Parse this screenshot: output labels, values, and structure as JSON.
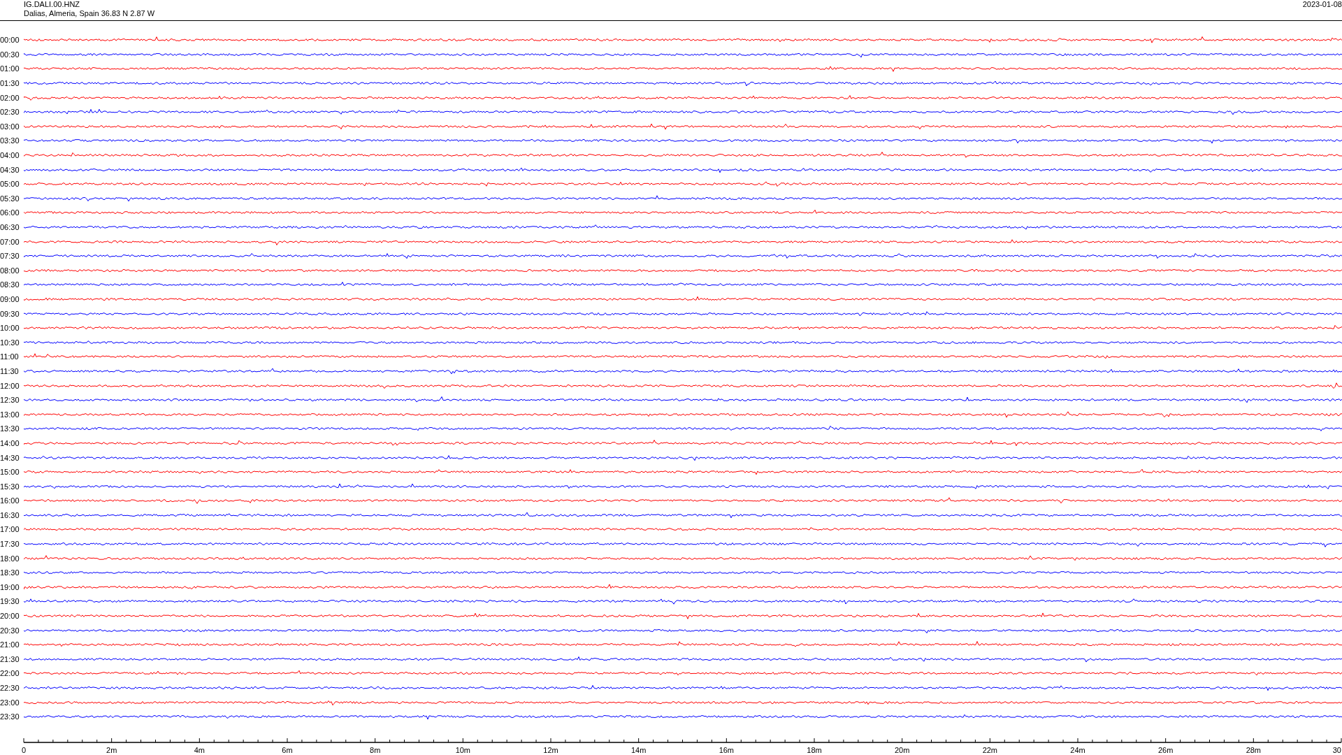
{
  "header": {
    "station": "IG.DALI.00.HNZ",
    "location": "Dalias, Almeria, Spain  36.83 N 2.87 W",
    "date": "2023-01-08"
  },
  "rows": [
    {
      "label": "00:00",
      "color": "#ff0000"
    },
    {
      "label": "00:30",
      "color": "#0000ff"
    },
    {
      "label": "01:00",
      "color": "#ff0000"
    },
    {
      "label": "01:30",
      "color": "#0000ff"
    },
    {
      "label": "02:00",
      "color": "#ff0000"
    },
    {
      "label": "02:30",
      "color": "#0000ff"
    },
    {
      "label": "03:00",
      "color": "#ff0000"
    },
    {
      "label": "03:30",
      "color": "#0000ff"
    },
    {
      "label": "04:00",
      "color": "#ff0000"
    },
    {
      "label": "04:30",
      "color": "#0000ff"
    },
    {
      "label": "05:00",
      "color": "#ff0000"
    },
    {
      "label": "05:30",
      "color": "#0000ff"
    },
    {
      "label": "06:00",
      "color": "#ff0000"
    },
    {
      "label": "06:30",
      "color": "#0000ff"
    },
    {
      "label": "07:00",
      "color": "#ff0000"
    },
    {
      "label": "07:30",
      "color": "#0000ff"
    },
    {
      "label": "08:00",
      "color": "#ff0000"
    },
    {
      "label": "08:30",
      "color": "#0000ff"
    },
    {
      "label": "09:00",
      "color": "#ff0000"
    },
    {
      "label": "09:30",
      "color": "#0000ff"
    },
    {
      "label": "10:00",
      "color": "#ff0000"
    },
    {
      "label": "10:30",
      "color": "#0000ff"
    },
    {
      "label": "11:00",
      "color": "#ff0000"
    },
    {
      "label": "11:30",
      "color": "#0000ff"
    },
    {
      "label": "12:00",
      "color": "#ff0000"
    },
    {
      "label": "12:30",
      "color": "#0000ff"
    },
    {
      "label": "13:00",
      "color": "#ff0000"
    },
    {
      "label": "13:30",
      "color": "#0000ff"
    },
    {
      "label": "14:00",
      "color": "#ff0000"
    },
    {
      "label": "14:30",
      "color": "#0000ff"
    },
    {
      "label": "15:00",
      "color": "#ff0000"
    },
    {
      "label": "15:30",
      "color": "#0000ff"
    },
    {
      "label": "16:00",
      "color": "#ff0000"
    },
    {
      "label": "16:30",
      "color": "#0000ff"
    },
    {
      "label": "17:00",
      "color": "#ff0000"
    },
    {
      "label": "17:30",
      "color": "#0000ff"
    },
    {
      "label": "18:00",
      "color": "#ff0000"
    },
    {
      "label": "18:30",
      "color": "#0000ff"
    },
    {
      "label": "19:00",
      "color": "#ff0000"
    },
    {
      "label": "19:30",
      "color": "#0000ff"
    },
    {
      "label": "20:00",
      "color": "#ff0000"
    },
    {
      "label": "20:30",
      "color": "#0000ff"
    },
    {
      "label": "21:00",
      "color": "#ff0000"
    },
    {
      "label": "21:30",
      "color": "#0000ff"
    },
    {
      "label": "22:00",
      "color": "#ff0000"
    },
    {
      "label": "22:30",
      "color": "#0000ff"
    },
    {
      "label": "23:00",
      "color": "#ff0000"
    },
    {
      "label": "23:30",
      "color": "#0000ff"
    }
  ],
  "x_axis": {
    "labels": [
      "0",
      "2m",
      "4m",
      "6m",
      "8m",
      "10m",
      "12m",
      "14m",
      "16m",
      "18m",
      "20m",
      "22m",
      "24m",
      "26m",
      "28m",
      "30"
    ]
  }
}
